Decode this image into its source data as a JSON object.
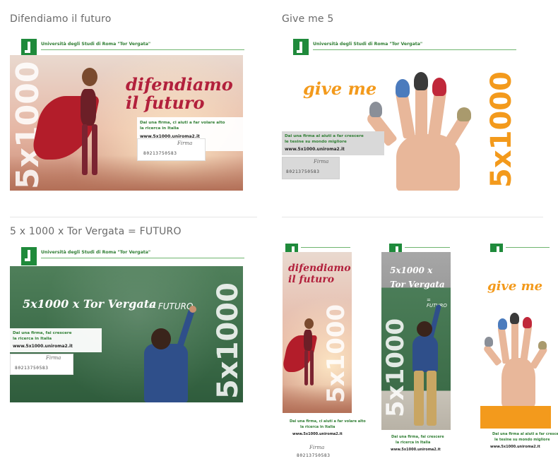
{
  "sections": {
    "s1": "Difendiamo il futuro",
    "s2": "Give me 5",
    "s3": "5 x 1000 x Tor Vergata = FUTURO"
  },
  "header": {
    "university": "Università degli Studi di Roma \"Tor Vergata\""
  },
  "banners": {
    "five_x": "5x1000",
    "difendiamo_line1": "difendiamo",
    "difendiamo_line2": "il futuro",
    "give_me": "give me",
    "chalk_main": "5x1000 x Tor Vergata",
    "chalk_eq": "= FUTURO",
    "info1_line1": "Dai una firma, ci aiuti a far volare alto",
    "info1_line2": "la ricerca in Italia",
    "info2_line1": "Dai una firma al aiuti a far crescere",
    "info2_line2": "le tesine su mondo migliore",
    "info3_line1": "Dai una firma, fai crescere",
    "info3_line2": "la ricerca in Italia",
    "url": "www.5x1000.uniroma2.it",
    "firma": "Firma",
    "code": "80213750583"
  },
  "vertical": {
    "v1_line1": "difendiamo",
    "v1_line2": "il futuro",
    "v2_line1": "5x1000 x",
    "v2_line2": "Tor Vergata",
    "v2_line3": "= FUTURO",
    "v3_title": "give me"
  },
  "colors": {
    "green": "#2e7d32",
    "red": "#b2203c",
    "orange": "#f39a1c"
  }
}
